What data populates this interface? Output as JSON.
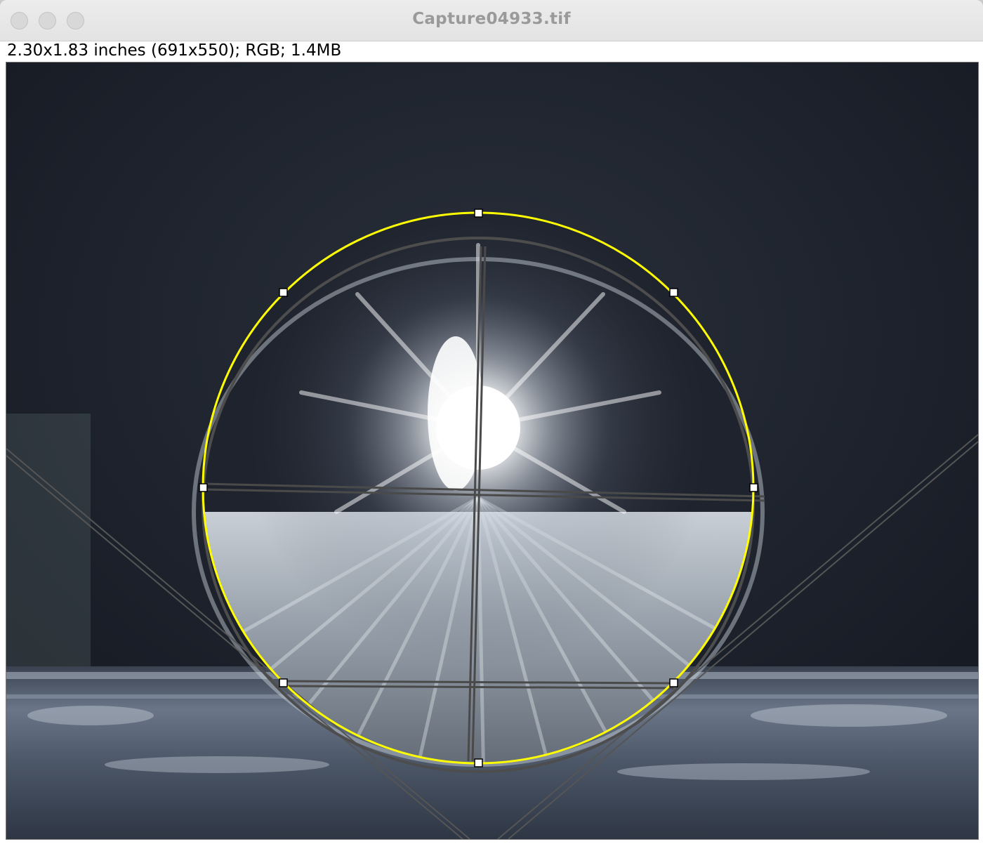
{
  "window": {
    "title": "Capture04933.tif",
    "controls": [
      "close-button",
      "minimize-button",
      "zoom-button"
    ]
  },
  "image_info": "2.30x1.83 inches (691x550); RGB; 1.4MB",
  "image": {
    "subject": "water droplet on textured surface with bright light reflection",
    "overlay_color": "#ffff00",
    "handle_color": "#ffffff",
    "guide_line_color": "#555555"
  }
}
